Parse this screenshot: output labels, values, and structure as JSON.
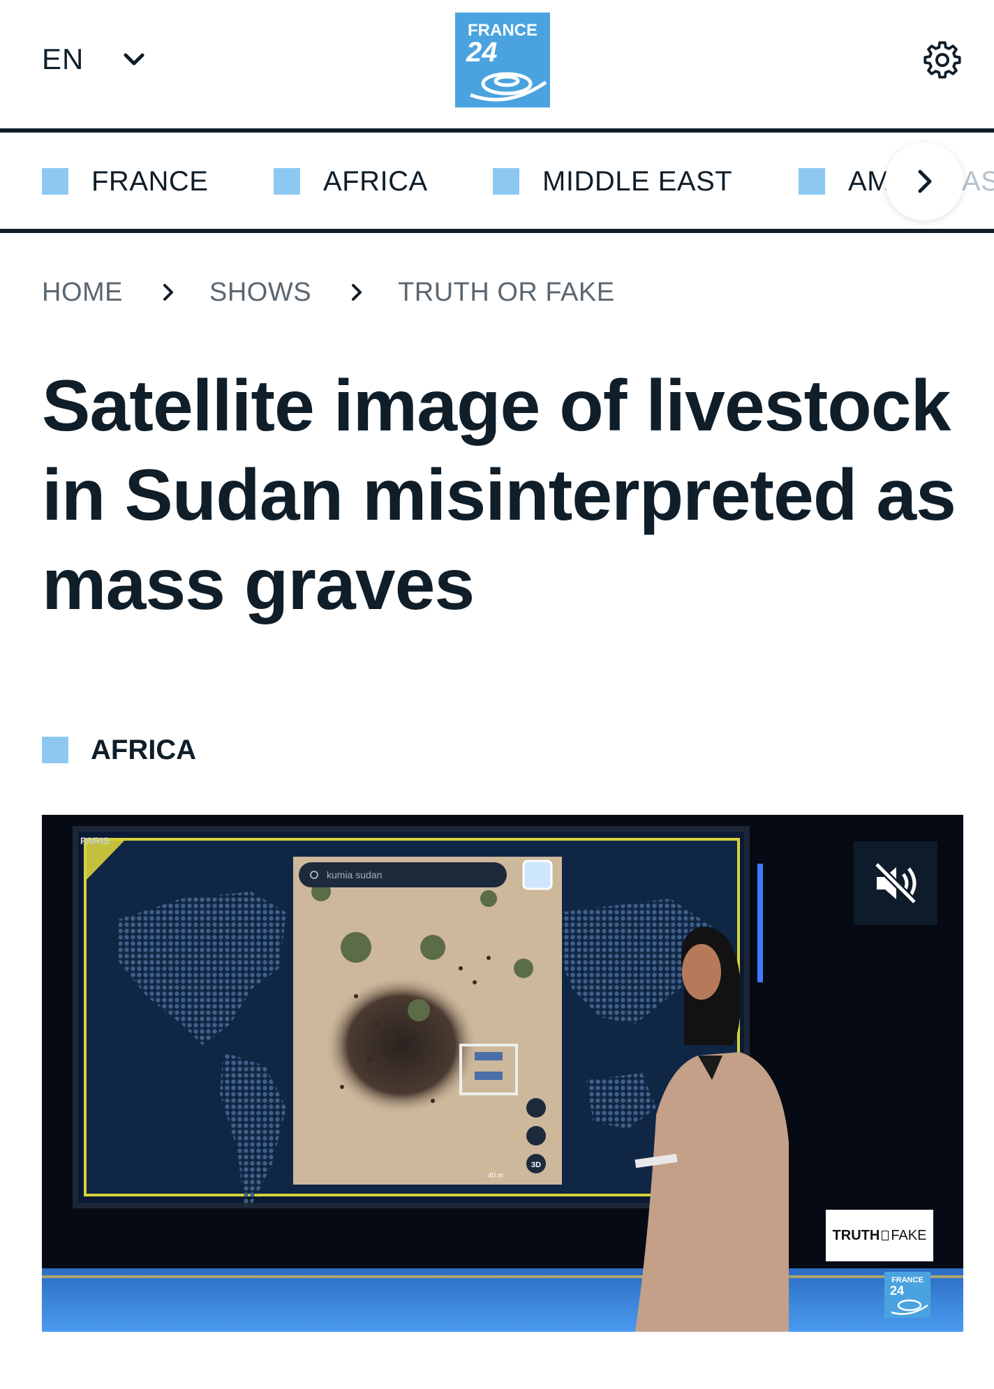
{
  "header": {
    "language": "EN",
    "logo_line1": "FRANCE",
    "logo_line2": "24",
    "brand_color": "#4aa3df"
  },
  "nav": {
    "items": [
      {
        "label": "FRANCE"
      },
      {
        "label": "AFRICA"
      },
      {
        "label": "MIDDLE EAST"
      },
      {
        "label": "AM"
      },
      {
        "label": "AS"
      }
    ],
    "accent_color": "#8cc8f1"
  },
  "breadcrumb": [
    "HOME",
    "SHOWS",
    "TRUTH OR FAKE"
  ],
  "article": {
    "title": "Satellite image of livestock in Sudan misinterpreted as mass graves",
    "category": "AFRICA"
  },
  "video": {
    "muted": true,
    "screen_label": "PARIS",
    "search_text": "kumia sudan",
    "map_button_3d": "3D",
    "scale_label": "40 m",
    "badge_truth": "TRUTH",
    "badge_fake": "FAKE",
    "mini_logo_line1": "FRANCE",
    "mini_logo_line2": "24"
  }
}
